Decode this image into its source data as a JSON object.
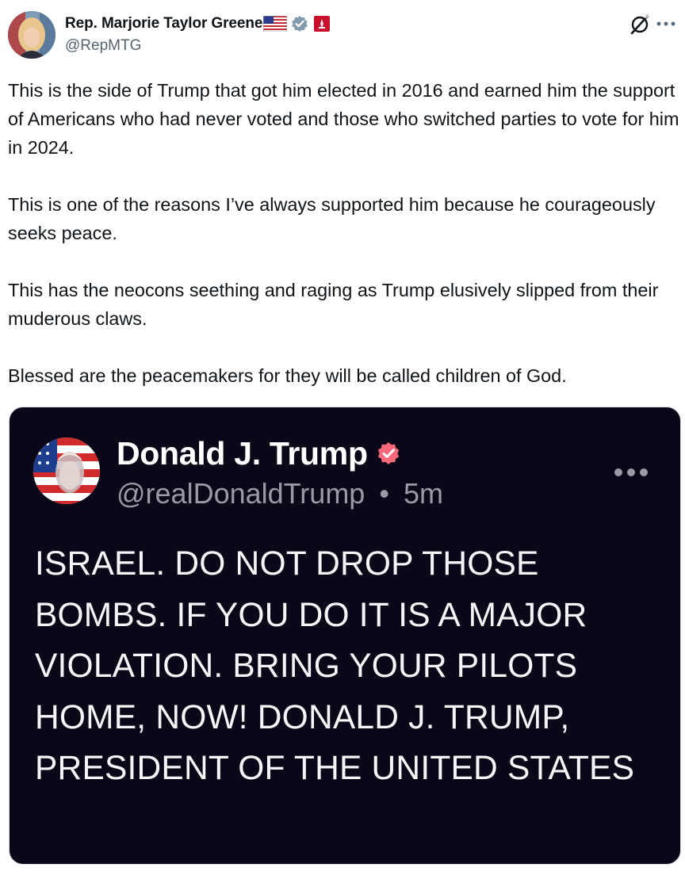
{
  "author": {
    "display_name": "Rep. Marjorie Taylor Greene",
    "handle": "@RepMTG",
    "icons": [
      "us-flag-icon",
      "verified-badge-icon",
      "affiliate-badge-icon"
    ]
  },
  "header_actions": {
    "grok_icon": "grok-icon",
    "more_icon": "more-options-icon"
  },
  "tweet": {
    "paragraphs": [
      "This is the side of Trump that got him elected in 2016 and earned him the support of Americans who had never voted and those who switched parties to vote for him in 2024.",
      "This is one of the reasons I’ve always supported him because he courageously seeks peace.",
      "This has the neocons seething and raging as Trump elusively slipped from their muderous claws.",
      "Blessed are the peacemakers for they will be called children of God."
    ]
  },
  "embedded": {
    "display_name": "Donald J. Trump",
    "handle": "@realDonaldTrump",
    "separator": "•",
    "time": "5m",
    "text": "ISRAEL. DO NOT DROP THOSE BOMBS. IF YOU DO IT IS A MAJOR VIOLATION. BRING YOUR PILOTS HOME, NOW! DONALD J. TRUMP, PRESIDENT OF THE UNITED STATES"
  },
  "colors": {
    "text_primary": "#0f1419",
    "text_secondary": "#536471",
    "verified_gray": "#829aab",
    "affiliate_red": "#c8102e",
    "card_background": "#0a0818",
    "card_text": "#f5f5f7",
    "card_secondary": "#9a99a6",
    "truth_badge": "#f5697a"
  }
}
